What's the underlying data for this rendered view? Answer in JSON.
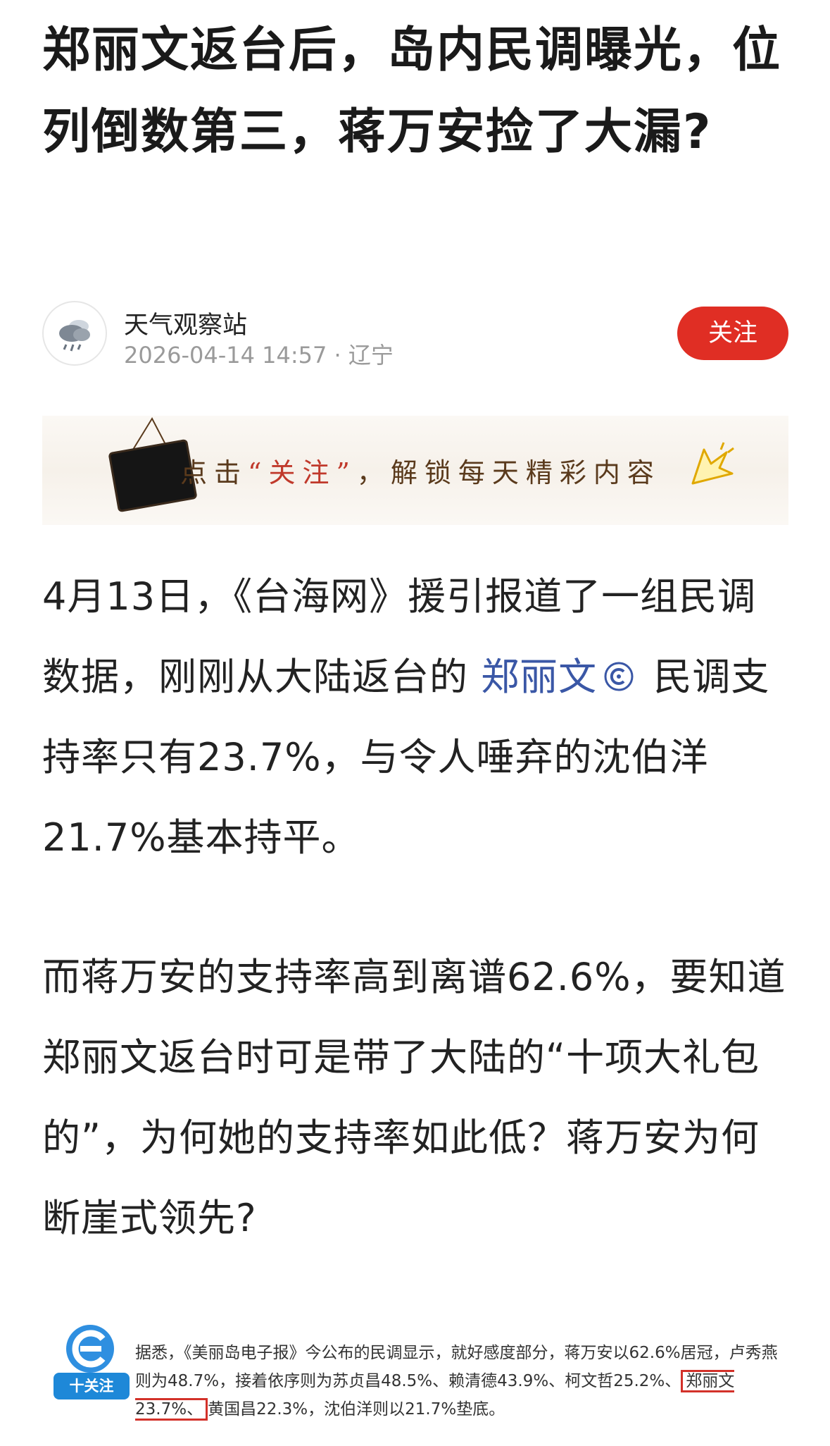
{
  "article": {
    "title": "郑丽文返台后，岛内民调曝光，位列倒数第三，蒋万安捡了大漏?"
  },
  "author": {
    "name": "天气观察站",
    "datetime": "2026-04-14 14:57",
    "location": "· 辽宁",
    "follow_label": "关注"
  },
  "banner": {
    "text_before": "点击",
    "text_highlight": "“关注”",
    "text_after": "，解锁每天精彩内容"
  },
  "body": {
    "p1_before": "4月13日，《台海网》援引报道了一组民调数据，刚刚从大陆返台的 ",
    "p1_link": "郑丽文",
    "p1_after": " 民调支持率只有23.7%，与令人唾弃的沈伯洋21.7%基本持平。",
    "p2": "而蒋万安的支持率高到离谱62.6%，要知道郑丽文返台时可是带了大陆的“十项大礼包的”，为何她的支持率如此低？蒋万安为何断崖式领先?"
  },
  "quote": {
    "follow_label": "十关注",
    "text_before": "据悉，《美丽岛电子报》今公布的民调显示，就好感度部分，蒋万安以62.6%居冠，卢秀燕则为48.7%，接着依序则为苏贞昌48.5%、赖清德43.9%、柯文哲25.2%、",
    "text_boxed": "郑丽文23.7%、",
    "text_after": "黄国昌22.3%，沈伯洋则以21.7%垫底。"
  },
  "colors": {
    "follow_button": "#e02e24",
    "link": "#3a57a6",
    "highlight_box": "#d3312a"
  },
  "icons": [
    "weather-cloud-icon",
    "baike-icon",
    "chalkboard-icon",
    "pointer-cursor-icon",
    "source-logo-icon"
  ]
}
